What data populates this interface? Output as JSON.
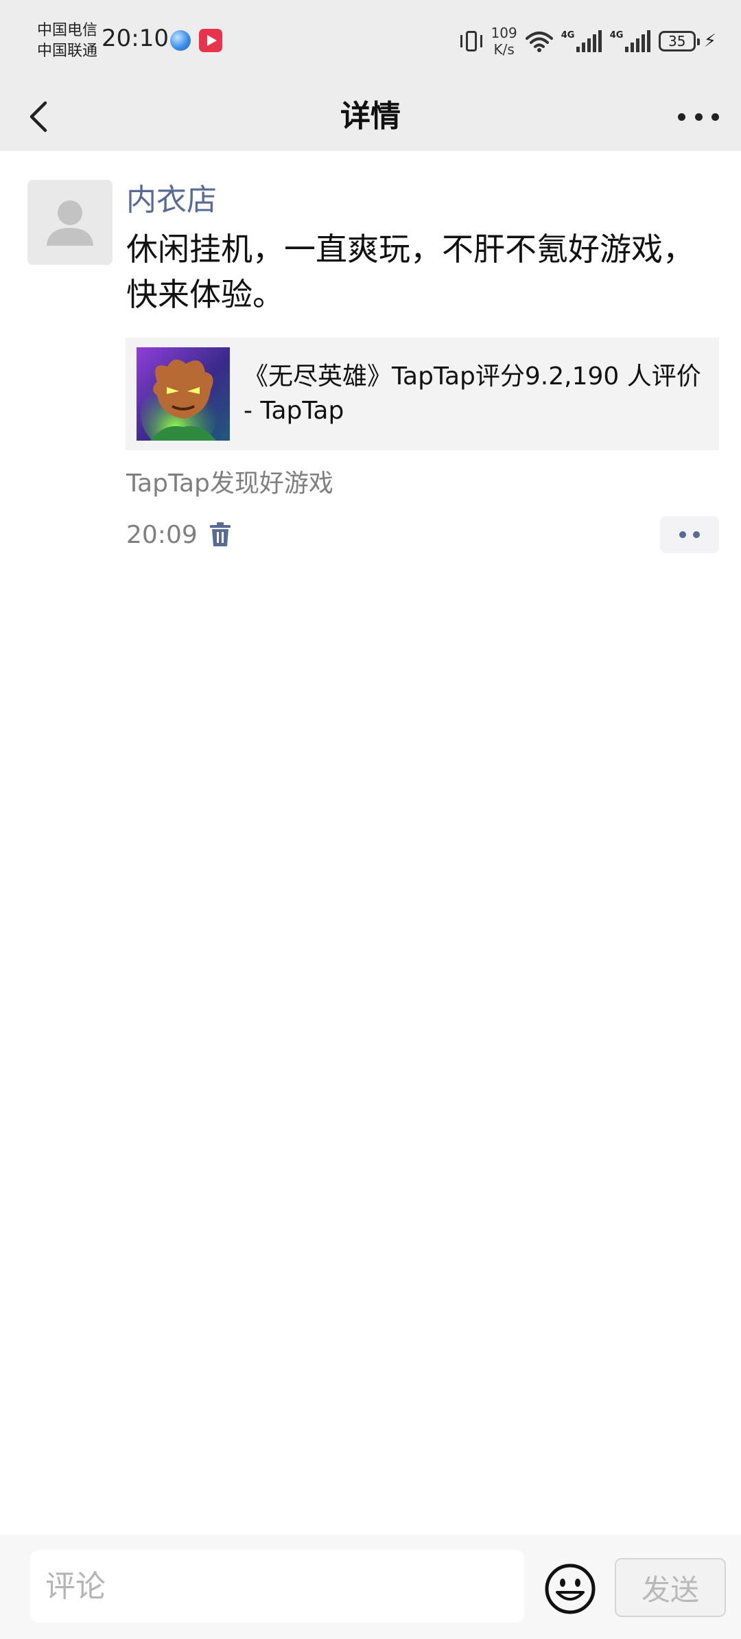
{
  "status_bar": {
    "carrier_1": "中国电信",
    "carrier_2": "中国联通",
    "time": "20:10",
    "speed_value": "109",
    "speed_unit": "K/s",
    "signal_1_tag": "4G",
    "signal_2_tag": "4G",
    "battery": "35",
    "icons": [
      "browser-app-icon",
      "video-app-icon",
      "vibrate-icon",
      "wifi-icon",
      "signal-icon",
      "battery-icon",
      "charging-icon"
    ]
  },
  "header": {
    "title": "详情",
    "back_icon": "chevron-left-icon",
    "more_icon": "more-dots-icon"
  },
  "post": {
    "author": "内衣店",
    "text": "休闲挂机，一直爽玩，不肝不氪好游戏，快来体验。",
    "link_card": {
      "title": "《无尽英雄》TapTap评分9.2,190 人评价 - TapTap",
      "thumbnail_icon": "game-thumbnail"
    },
    "source": "TapTap发现好游戏",
    "time": "20:09",
    "delete_icon": "trash-icon",
    "action_icon": "more-dots-icon"
  },
  "comment_bar": {
    "placeholder": "评论",
    "emoji_icon": "emoji-icon",
    "send_label": "发送"
  },
  "colors": {
    "header_bg": "#ededed",
    "link_blue": "#576b95",
    "secondary_text": "#7f7f7f",
    "card_bg": "#f3f3f3"
  }
}
